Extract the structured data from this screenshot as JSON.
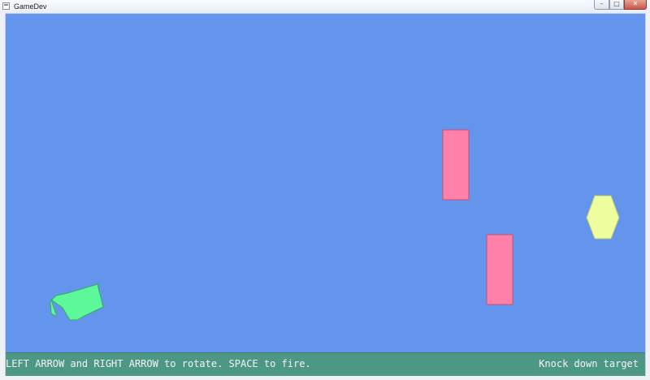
{
  "window": {
    "title": "GameDev",
    "minimize_glyph": "–",
    "maximize_glyph": "□",
    "close_glyph": "✕"
  },
  "game": {
    "background_color": "#6495ed",
    "cannon": {
      "color": "#5cf89a",
      "outline": "#3ca86a"
    },
    "blocks": {
      "color": "#ff80a8",
      "outline": "#c9506f",
      "count": 2
    },
    "target": {
      "color": "#eefe9e",
      "outline": "#b8c870",
      "shape": "hexagon"
    }
  },
  "hud": {
    "instructions": "LEFT ARROW and RIGHT ARROW to rotate. SPACE to fire.",
    "status": "Knock down target",
    "background_color": "#4d9884"
  }
}
